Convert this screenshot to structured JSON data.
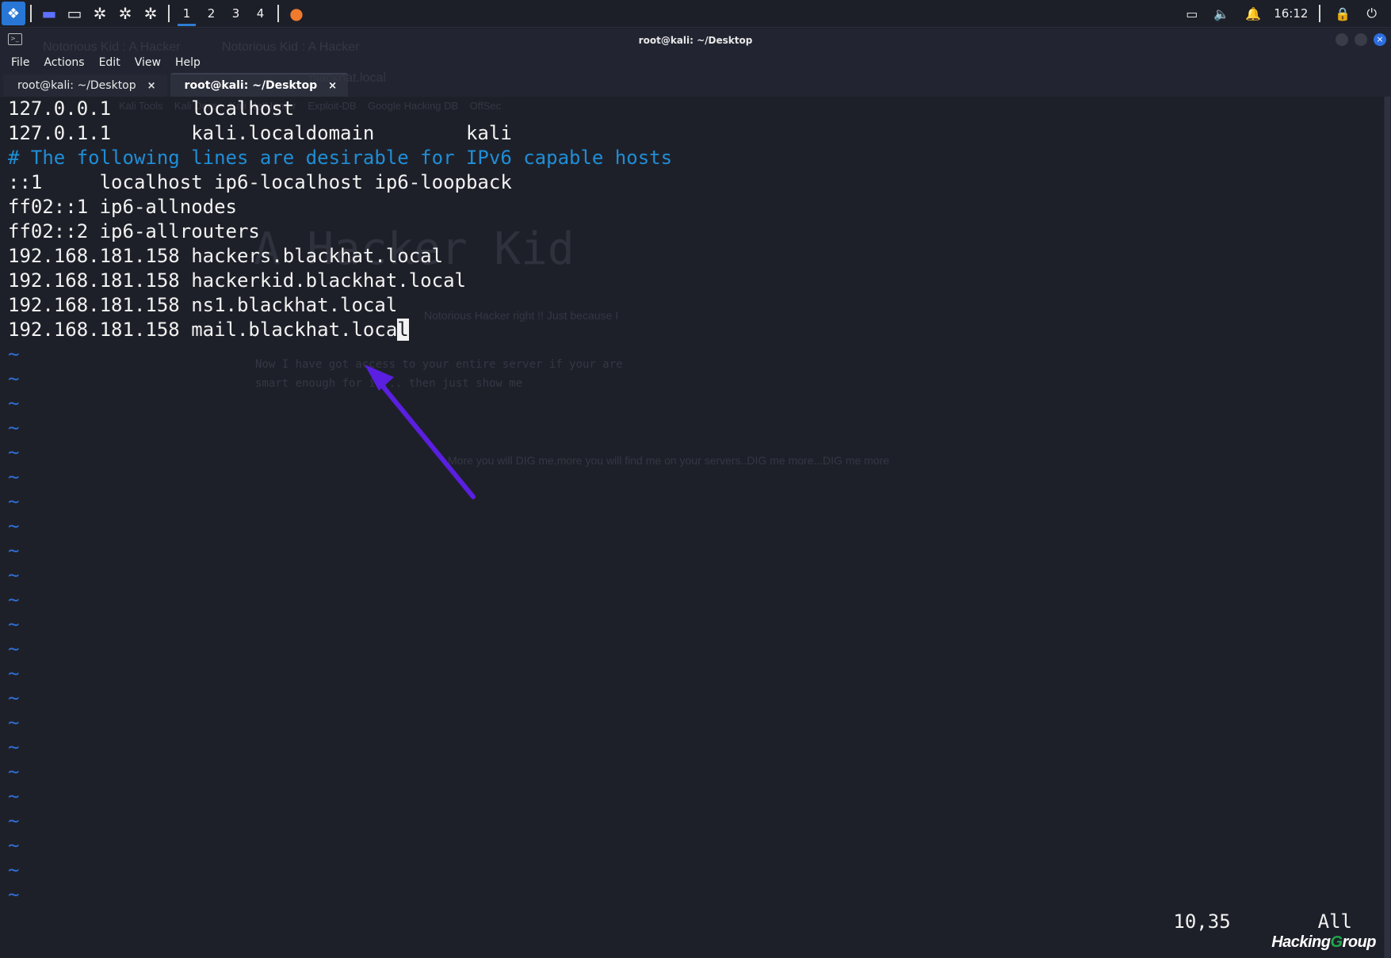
{
  "panel": {
    "workspaces": [
      "1",
      "2",
      "3",
      "4"
    ],
    "active_workspace": "1",
    "clock": "16:12",
    "icons": [
      "kali-menu-icon",
      "desktop-icon",
      "file-manager-icon",
      "settings-gear-icon",
      "settings-gear-icon",
      "settings-gear-icon",
      "firefox-icon",
      "terminal-icon",
      "display-icon",
      "volume-icon",
      "notification-bell-icon",
      "lock-icon",
      "logout-icon"
    ]
  },
  "window": {
    "title": "root@kali: ~/Desktop"
  },
  "menubar": {
    "file": "File",
    "actions": "Actions",
    "edit": "Edit",
    "view": "View",
    "help": "Help"
  },
  "tabs": [
    {
      "label": "root@kali: ~/Desktop",
      "close": "×"
    },
    {
      "label": "root@kali: ~/Desktop",
      "close": "×"
    }
  ],
  "terminal": {
    "lines": [
      "127.0.0.1       localhost",
      "127.0.1.1       kali.localdomain        kali",
      "# The following lines are desirable for IPv6 capable hosts",
      "::1     localhost ip6-localhost ip6-loopback",
      "ff02::1 ip6-allnodes",
      "ff02::2 ip6-allrouters",
      "192.168.181.158 hackers.blackhat.local",
      "192.168.181.158 hackerkid.blackhat.local",
      "192.168.181.158 ns1.blackhat.local",
      "192.168.181.158 mail.blackhat.loca"
    ],
    "cursor_char": "l",
    "tilde": "~",
    "position": "10,35",
    "scroll": "All"
  },
  "background_ghost": {
    "heading": "A Hacker Kid",
    "tab1": "Notorious Kid : A Hacker",
    "tab2": "Notorious Kid : A Hacker",
    "url": "blackhat.local",
    "bookmarks": "Kali Tools    Kali Docs    Kali NetHunter    Exploit-DB    Google Hacking DB    OffSec",
    "line1": "Notorious Hacker right !! Just because I",
    "line2": "Now I have got access to your entire server if your are",
    "line3": "smart enough for it... then just show me",
    "line4": "More you will DIG me,more you will find me on your servers..DIG me more...DIG me more"
  },
  "watermark": {
    "part1": "Hacking",
    "part2": "G",
    "part3": "roup"
  },
  "colors": {
    "terminal_bg": "#1e2029",
    "comment": "#1f8ed6",
    "tilde": "#2d6fd6",
    "arrow": "#5a1fe0",
    "accent": "#2f7bd1"
  }
}
